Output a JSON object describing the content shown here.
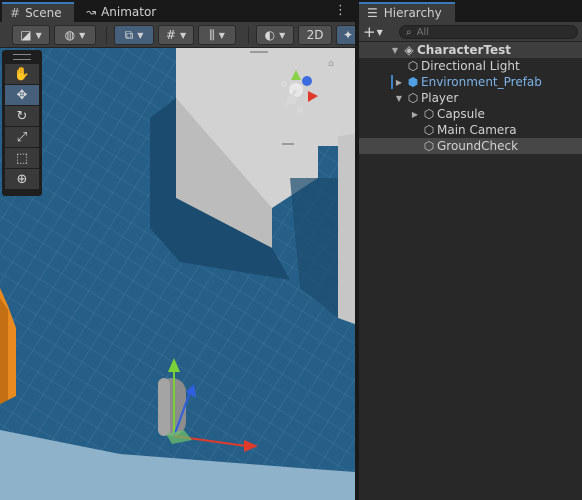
{
  "scene_tabs": [
    {
      "label": "Scene",
      "icon": "grid-icon",
      "active": true
    },
    {
      "label": "Animator",
      "icon": "animator-icon",
      "active": false
    }
  ],
  "scene_toolbar": {
    "mode_2d_label": "2D"
  },
  "hierarchy": {
    "tab_label": "Hierarchy",
    "search_placeholder": "All",
    "items": [
      {
        "label": "CharacterTest",
        "depth": 0,
        "expanded": true,
        "type": "scene"
      },
      {
        "label": "Directional Light",
        "depth": 1,
        "expanded": null,
        "type": "object"
      },
      {
        "label": "Environment_Prefab",
        "depth": 1,
        "expanded": false,
        "type": "prefab"
      },
      {
        "label": "Player",
        "depth": 1,
        "expanded": true,
        "type": "object"
      },
      {
        "label": "Capsule",
        "depth": 2,
        "expanded": false,
        "type": "object"
      },
      {
        "label": "Main Camera",
        "depth": 2,
        "expanded": null,
        "type": "object"
      },
      {
        "label": "GroundCheck",
        "depth": 2,
        "expanded": null,
        "type": "object",
        "selected": true
      }
    ]
  },
  "colors": {
    "accent": "#3a79bb",
    "prefab": "#52a0e4",
    "axis_x": "#e03a2a",
    "axis_y": "#7ad13a",
    "axis_z": "#2e5fe0"
  }
}
